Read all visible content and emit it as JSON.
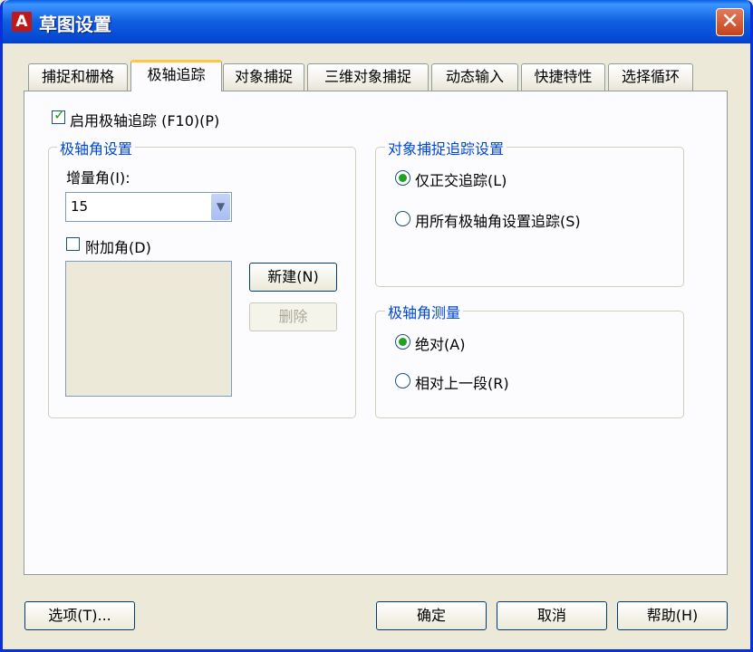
{
  "window": {
    "title": "草图设置",
    "app_icon": "autocad-icon",
    "close_label": "✕"
  },
  "tabs": [
    {
      "label": "捕捉和栅格",
      "active": false
    },
    {
      "label": "极轴追踪",
      "active": true
    },
    {
      "label": "对象捕捉",
      "active": false
    },
    {
      "label": "三维对象捕捉",
      "active": false
    },
    {
      "label": "动态输入",
      "active": false
    },
    {
      "label": "快捷特性",
      "active": false
    },
    {
      "label": "选择循环",
      "active": false
    }
  ],
  "polar": {
    "enable_label": "启用极轴追踪 (F10)(P)",
    "enable_checked": true
  },
  "angle_settings": {
    "title": "极轴角设置",
    "increment_label": "增量角(I):",
    "increment_value": "15",
    "additional_label": "附加角(D)",
    "additional_checked": false,
    "new_button": "新建(N)",
    "delete_button": "删除"
  },
  "snap_tracking": {
    "title": "对象捕捉追踪设置",
    "options": [
      {
        "label": "仅正交追踪(L)",
        "selected": true
      },
      {
        "label": "用所有极轴角设置追踪(S)",
        "selected": false
      }
    ]
  },
  "measurement": {
    "title": "极轴角测量",
    "options": [
      {
        "label": "绝对(A)",
        "selected": true
      },
      {
        "label": "相对上一段(R)",
        "selected": false
      }
    ]
  },
  "footer": {
    "options_button": "选项(T)...",
    "ok_button": "确定",
    "cancel_button": "取消",
    "help_button": "帮助(H)"
  }
}
